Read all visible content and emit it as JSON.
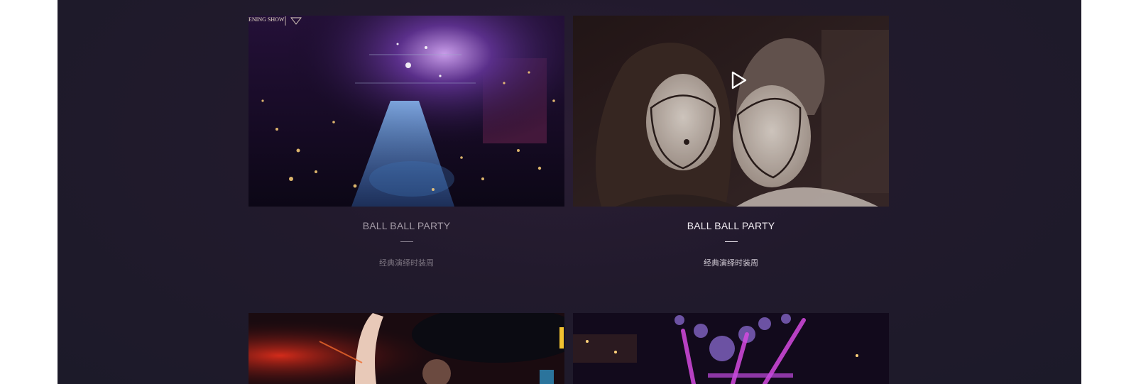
{
  "gallery": {
    "items": [
      {
        "title": "BALL BALL PARTY",
        "subtitle": "经典演绎时装周",
        "logo_text": "ENING SHOW",
        "image": "nightclub-overhead-crowd"
      },
      {
        "title": "BALL BALL PARTY",
        "subtitle": "经典演绎时装周",
        "image": "two-women-face-paint",
        "icon": "play-icon"
      },
      {
        "image": "party-crowd-red-lights"
      },
      {
        "image": "disco-balls-purple-lights"
      }
    ]
  },
  "colors": {
    "background": "#211a2c",
    "title_active": "#f1ecf2",
    "title_inactive": "#a39aa6"
  }
}
